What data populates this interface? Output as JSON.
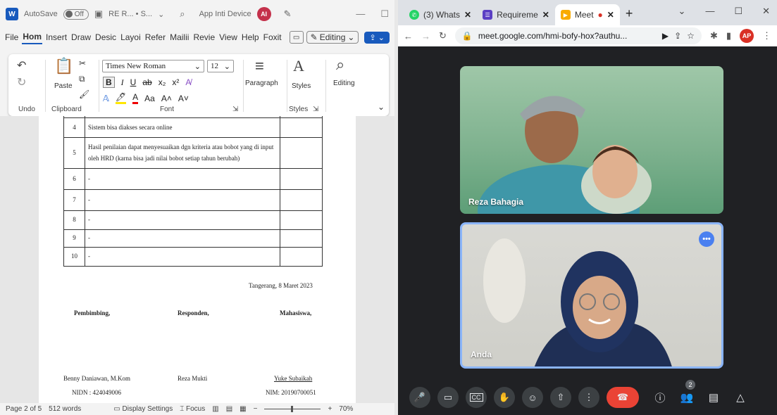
{
  "word": {
    "app_icon": "W",
    "autosave_label": "AutoSave",
    "autosave_state": "Off",
    "doc_title": "RE R... • S...",
    "title_chevron": "⌄",
    "search_hint": "App Inti Device",
    "user_initials": "AI",
    "tabs": [
      "File",
      "Hom",
      "Insert",
      "Draw",
      "Desic",
      "Layoi",
      "Refer",
      "Mailii",
      "Revie",
      "View",
      "Help",
      "Foxit"
    ],
    "editing_label": "Editing",
    "ribbon": {
      "undo_label": "Undo",
      "paste_label": "Paste",
      "clipboard_label": "Clipboard",
      "font_name": "Times New Roman",
      "font_size": "12",
      "font_label": "Font",
      "paragraph_label": "Paragraph",
      "styles_label": "Styles",
      "styles_group_label": "Styles",
      "editing_label": "Editing",
      "bold": "B",
      "italic": "I",
      "underline": "U",
      "strike": "ab",
      "sub": "x₂",
      "sup": "x²",
      "case": "Aa",
      "grow": "A˄",
      "shrink": "A˅"
    },
    "table_rows": [
      {
        "num": "4",
        "text": "Sistem bisa diakses secara online"
      },
      {
        "num": "5",
        "text": "Hasil penilaian dapat menyesuaikan dgn kriteria atau bobot yang di input oleh HRD (karna bisa jadi nilai bobot setiap tahun berubah)"
      },
      {
        "num": "6",
        "text": "-"
      },
      {
        "num": "7",
        "text": "-"
      },
      {
        "num": "8",
        "text": "-"
      },
      {
        "num": "9",
        "text": "-"
      },
      {
        "num": "10",
        "text": "-"
      }
    ],
    "place_date": "Tangerang, 8 Maret 2023",
    "signatures": [
      {
        "role": "Pembimbing,",
        "name": "Benny Daniawan, M.Kom",
        "id": "NIDN : 424049006"
      },
      {
        "role": "Responden,",
        "name": "Reza Mukti",
        "id": ""
      },
      {
        "role": "Mahasiswa,",
        "name": "Yuke Subaikah",
        "id": "NIM: 20190700051"
      }
    ],
    "status": {
      "page": "Page 2 of 5",
      "words": "512 words",
      "display_settings": "Display Settings",
      "focus": "Focus",
      "zoom": "70%"
    }
  },
  "chrome": {
    "tabs": [
      {
        "label": "(3) Whats",
        "favicon_color": "#25d366",
        "favicon": "✆"
      },
      {
        "label": "Requireme",
        "favicon_color": "#5b3fc4",
        "favicon": "☰"
      },
      {
        "label": "Meet",
        "favicon_color": "#f9ab00",
        "favicon": "▶",
        "recording": "●"
      }
    ],
    "url": "meet.google.com/hmi-bofy-hox?authu...",
    "profile_initials": "AP"
  },
  "meet": {
    "participants": [
      {
        "name": "Reza Bahagia"
      },
      {
        "name": "Anda"
      }
    ],
    "people_count": "2",
    "more_dots": "•••"
  },
  "colors": {
    "word_blue": "#185abd",
    "meet_red": "#ea4335",
    "meet_bg": "#202124",
    "tile_border": "#8ab4f8"
  }
}
